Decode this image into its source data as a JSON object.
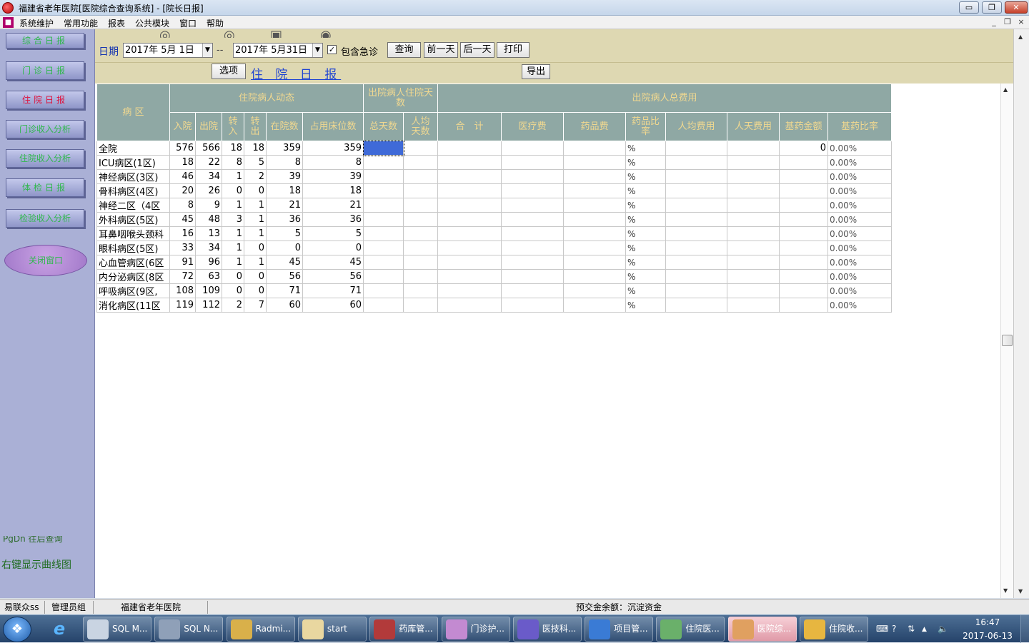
{
  "window": {
    "title": "福建省老年医院[医院综合查询系统] - [院长日报]",
    "min": "▭",
    "restore": "❐",
    "close": "✕"
  },
  "menu": {
    "items": [
      "系统维护",
      "常用功能",
      "报表",
      "公共模块",
      "窗口",
      "帮助"
    ],
    "mdi_min": "_",
    "mdi_restore": "❐",
    "mdi_close": "×"
  },
  "sidebar": {
    "buttons": [
      "综合日报",
      "门诊日报",
      "住院日报",
      "门诊收入分析",
      "住院收入分析",
      "体检日报",
      "检验收入分析"
    ],
    "active_index": 2,
    "oval_label": "关闭窗口",
    "cut_text": "PgDn 往后查询",
    "hint": "右键显示曲线图"
  },
  "toolbar": {
    "date_label": "日期",
    "date_from": "2017年 5月 1日",
    "separator": "--",
    "date_to": "2017年 5月31日",
    "include_emergency_checked": true,
    "include_emergency_label": "包含急诊",
    "query": "查询",
    "prev_day": "前一天",
    "next_day": "后一天",
    "print": "打印",
    "options": "选项",
    "report_title": "住 院 日 报",
    "export": "导出"
  },
  "table": {
    "h_area": "病 区",
    "h_dynamics": "住院病人动态",
    "h_discharge_days": "出院病人住院天数",
    "h_total_cost": "出院病人总费用",
    "cols": [
      "入院",
      "出院",
      "转入",
      "转出",
      "在院数",
      "占用床位数",
      "总天数",
      "人均天数",
      "合　计",
      "医疗费",
      "药品费",
      "药品比率",
      "人均费用",
      "人天费用",
      "基药金额",
      "基药比率"
    ],
    "rows": [
      {
        "name": "全院",
        "admit": "576",
        "discharge": "566",
        "in": "18",
        "out": "18",
        "inpatients": "359",
        "beds": "359",
        "pct": "%",
        "essential_amount": "0",
        "essential_ratio": "0.00%"
      },
      {
        "name": "ICU病区(1区)",
        "admit": "18",
        "discharge": "22",
        "in": "8",
        "out": "5",
        "inpatients": "8",
        "beds": "8",
        "pct": "%",
        "essential_amount": "",
        "essential_ratio": "0.00%"
      },
      {
        "name": "神经病区(3区)",
        "admit": "46",
        "discharge": "34",
        "in": "1",
        "out": "2",
        "inpatients": "39",
        "beds": "39",
        "pct": "%",
        "essential_amount": "",
        "essential_ratio": "0.00%"
      },
      {
        "name": "骨科病区(4区)",
        "admit": "20",
        "discharge": "26",
        "in": "0",
        "out": "0",
        "inpatients": "18",
        "beds": "18",
        "pct": "%",
        "essential_amount": "",
        "essential_ratio": "0.00%"
      },
      {
        "name": "神经二区（4区",
        "admit": "8",
        "discharge": "9",
        "in": "1",
        "out": "1",
        "inpatients": "21",
        "beds": "21",
        "pct": "%",
        "essential_amount": "",
        "essential_ratio": "0.00%"
      },
      {
        "name": "外科病区(5区)",
        "admit": "45",
        "discharge": "48",
        "in": "3",
        "out": "1",
        "inpatients": "36",
        "beds": "36",
        "pct": "%",
        "essential_amount": "",
        "essential_ratio": "0.00%"
      },
      {
        "name": "耳鼻咽喉头颈科",
        "admit": "16",
        "discharge": "13",
        "in": "1",
        "out": "1",
        "inpatients": "5",
        "beds": "5",
        "pct": "%",
        "essential_amount": "",
        "essential_ratio": "0.00%"
      },
      {
        "name": "眼科病区(5区)",
        "admit": "33",
        "discharge": "34",
        "in": "1",
        "out": "0",
        "inpatients": "0",
        "beds": "0",
        "pct": "%",
        "essential_amount": "",
        "essential_ratio": "0.00%"
      },
      {
        "name": "心血管病区(6区",
        "admit": "91",
        "discharge": "96",
        "in": "1",
        "out": "1",
        "inpatients": "45",
        "beds": "45",
        "pct": "%",
        "essential_amount": "",
        "essential_ratio": "0.00%"
      },
      {
        "name": "内分泌病区(8区",
        "admit": "72",
        "discharge": "63",
        "in": "0",
        "out": "0",
        "inpatients": "56",
        "beds": "56",
        "pct": "%",
        "essential_amount": "",
        "essential_ratio": "0.00%"
      },
      {
        "name": "呼吸病区(9区,",
        "admit": "108",
        "discharge": "109",
        "in": "0",
        "out": "0",
        "inpatients": "71",
        "beds": "71",
        "pct": "%",
        "essential_amount": "",
        "essential_ratio": "0.00%"
      },
      {
        "name": "消化病区(11区",
        "admit": "119",
        "discharge": "112",
        "in": "2",
        "out": "7",
        "inpatients": "60",
        "beds": "60",
        "pct": "%",
        "essential_amount": "",
        "essential_ratio": "0.00%"
      }
    ]
  },
  "status": {
    "user": "易联众ss",
    "group": "管理员组",
    "hospital": "福建省老年医院",
    "balance": "预交金余额：沉淀资金"
  },
  "taskbar": {
    "start": "❖",
    "ie": "e",
    "items": [
      {
        "label": "SQL M...",
        "color": "#c9d4e2"
      },
      {
        "label": "SQL N...",
        "color": "#8fa0b8"
      },
      {
        "label": "Radmi...",
        "color": "#d9b04a"
      },
      {
        "label": "start",
        "color": "#e9d7a0"
      },
      {
        "label": "药库管...",
        "color": "#b23a3a"
      },
      {
        "label": "门诊护...",
        "color": "#c38ad1"
      },
      {
        "label": "医技科...",
        "color": "#6a5bc9"
      },
      {
        "label": "项目管...",
        "color": "#3a7bd5"
      },
      {
        "label": "住院医...",
        "color": "#6ab06a"
      },
      {
        "label": "医院综...",
        "color": "#e0a060"
      },
      {
        "label": "住院收...",
        "color": "#e7b640"
      }
    ],
    "active_index": 9,
    "tray": [
      "⌨",
      "?",
      "⇅",
      "▲",
      "🔈"
    ],
    "time": "16:47",
    "date": "2017-06-13"
  }
}
